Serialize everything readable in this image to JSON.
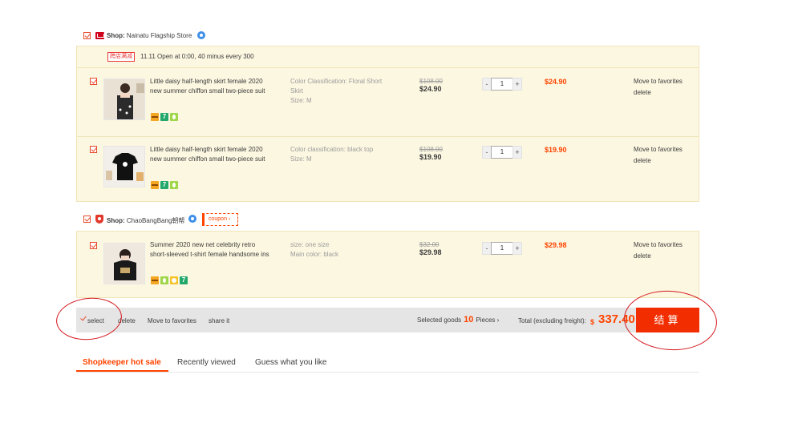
{
  "shops": [
    {
      "name_prefix": "Shop:",
      "name": "Nainatu Flagship Store",
      "promo_tag": "跨店满减",
      "promo_text": "11.11 Open at 0:00, 40 minus every 300",
      "items": [
        {
          "title": "Little daisy half-length skirt female 2020 new summer chiffon small two-piece suit",
          "attr_lines": [
            "Color Classification: Floral Short Skirt",
            "Size: M"
          ],
          "old_price": "$108.00",
          "new_price": "$24.90",
          "quantity": "1",
          "subtotal": "$24.90",
          "icons": [
            "card-icon",
            "seven-day-icon",
            "leaf-icon"
          ]
        },
        {
          "title": "Little daisy half-length skirt female 2020 new summer chiffon small two-piece suit",
          "attr_lines": [
            "Color classification: black top",
            "Size: M"
          ],
          "old_price": "$108.00",
          "new_price": "$19.90",
          "quantity": "1",
          "subtotal": "$19.90",
          "icons": [
            "card-icon",
            "seven-day-icon",
            "leaf-icon"
          ]
        }
      ]
    },
    {
      "name_prefix": "Shop:",
      "name": "ChaoBangBang朝帮",
      "coupon_label": "coupon",
      "items": [
        {
          "title": "Summer 2020 new net celebrity retro short-sleeved t-shirt female handsome ins",
          "attr_lines": [
            "size: one size",
            "Main color: black"
          ],
          "old_price": "$32.00",
          "new_price": "$29.98",
          "quantity": "1",
          "subtotal": "$29.98",
          "icons": [
            "card-icon",
            "leaf-icon",
            "sun-icon",
            "seven-day-icon"
          ]
        }
      ]
    }
  ],
  "item_actions": {
    "favorite": "Move to favorites",
    "delete": "delete"
  },
  "qty": {
    "minus": "-",
    "plus": "+"
  },
  "bottom_bar": {
    "select_label": "select",
    "delete_label": "delete",
    "favorites_label": "Move to favorites",
    "share_label": "share it",
    "selected_prefix": "Selected goods",
    "selected_count": "10",
    "selected_suffix": "Pieces",
    "total_label": "Total (excluding freight):",
    "currency": "$",
    "total_amount": "337.40",
    "checkout_label": "结算"
  },
  "tabs": [
    {
      "label": "Shopkeeper hot sale",
      "active": true
    },
    {
      "label": "Recently viewed",
      "active": false
    },
    {
      "label": "Guess what you like",
      "active": false
    }
  ],
  "colors": {
    "accent": "#ff4400",
    "checkout": "#f22d00",
    "group_bg": "#fcf7e1",
    "bar_bg": "#e5e5e5",
    "annotation": "#d4161c"
  }
}
